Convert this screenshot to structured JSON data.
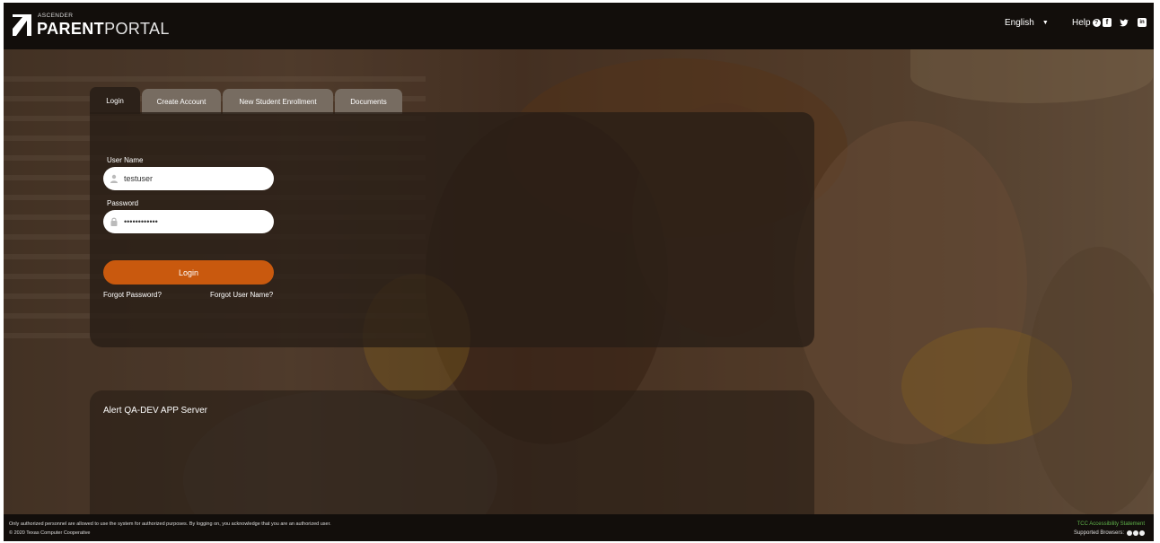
{
  "header": {
    "brand_top": "ASCENDER",
    "brand_bold": "PARENT",
    "brand_light": "PORTAL",
    "language": "English",
    "help_label": "Help",
    "help_icon": "?",
    "social": {
      "facebook": "f",
      "twitter": "t",
      "linkedin": "in"
    }
  },
  "tabs": [
    {
      "label": "Login",
      "active": true
    },
    {
      "label": "Create Account",
      "active": false
    },
    {
      "label": "New Student Enrollment",
      "active": false
    },
    {
      "label": "Documents",
      "active": false
    }
  ],
  "login": {
    "username_label": "User Name",
    "username_value": "testuser",
    "password_label": "Password",
    "password_value": "••••••••••••",
    "login_button": "Login",
    "forgot_password": "Forgot Password?",
    "forgot_username": "Forgot User Name?"
  },
  "alert": {
    "text": "Alert QA-DEV APP Server"
  },
  "footer": {
    "disclaimer": "Only authorized personnel are allowed to use the system for authorized purposes. By logging on, you acknowledge that you are an authorized user.",
    "copyright": "© 2020 Texas Computer Cooperative",
    "accessibility": "TCC Accessibility Statement",
    "browsers_label": "Supported Browsers:"
  },
  "colors": {
    "accent": "#c9590e",
    "header_bg": "#120e0b",
    "accessibility_link": "#5fb24a"
  },
  "icons": [
    "logo-mark-icon",
    "caret-down-icon",
    "question-icon",
    "facebook-icon",
    "twitter-icon",
    "linkedin-icon",
    "user-icon",
    "lock-icon",
    "browser-icon"
  ]
}
